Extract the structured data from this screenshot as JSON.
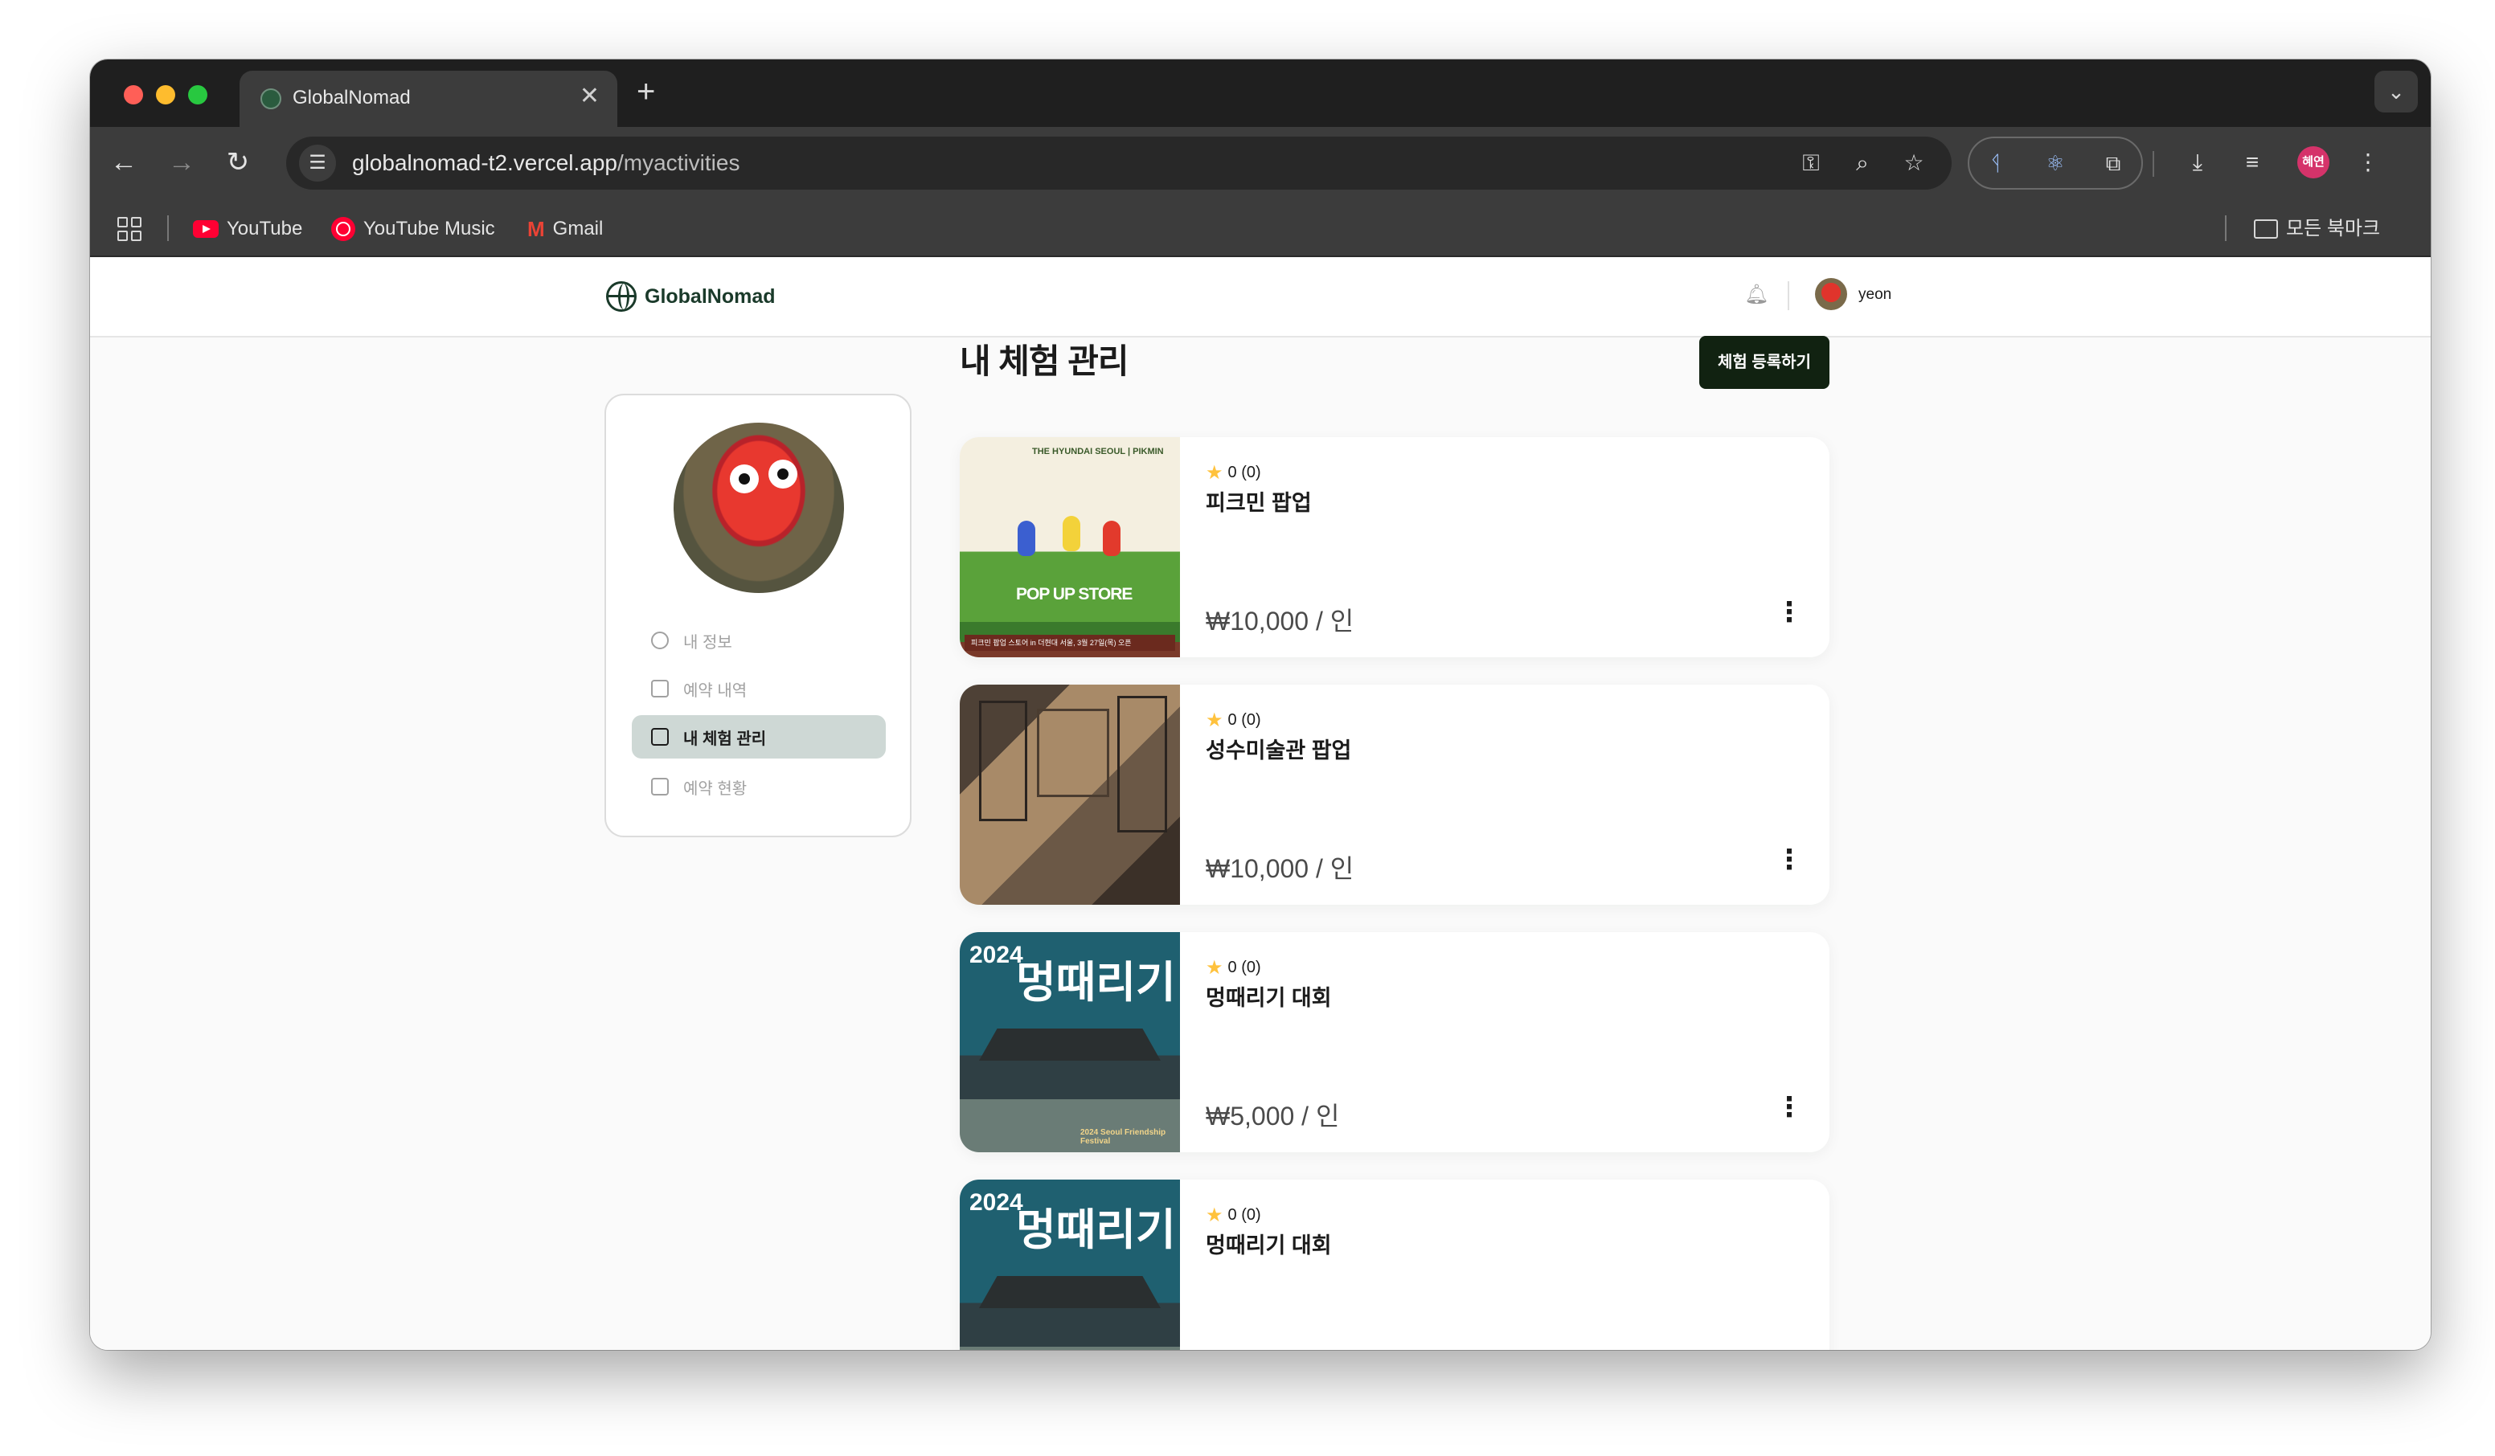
{
  "browser": {
    "tab_title": "GlobalNomad",
    "url_host": "globalnomad-t2.vercel.app",
    "url_path": "/myactivities",
    "profile_chip": "혜연",
    "bookmarks": [
      {
        "label": "YouTube",
        "icon": "youtube-icon"
      },
      {
        "label": "YouTube Music",
        "icon": "youtube-music-icon"
      },
      {
        "label": "Gmail",
        "icon": "gmail-icon"
      }
    ],
    "all_bookmarks": "모든 북마크"
  },
  "site": {
    "logo_text": "GlobalNomad",
    "username": "yeon"
  },
  "sidebar": {
    "items": [
      {
        "label": "내 정보",
        "icon": "user-icon",
        "active": false
      },
      {
        "label": "예약 내역",
        "icon": "list-icon",
        "active": false
      },
      {
        "label": "내 체험 관리",
        "icon": "calendar-check-icon",
        "active": true
      },
      {
        "label": "예약 현황",
        "icon": "calendar-icon",
        "active": false
      }
    ]
  },
  "main": {
    "title": "내 체험 관리",
    "register_button": "체험 등록하기",
    "activities": [
      {
        "rating": "0 (0)",
        "title": "피크민 팝업",
        "price": "₩10,000 / 인"
      },
      {
        "rating": "0 (0)",
        "title": "성수미술관 팝업",
        "price": "₩10,000 / 인"
      },
      {
        "rating": "0 (0)",
        "title": "멍때리기 대회",
        "price": "₩5,000 / 인"
      },
      {
        "rating": "0 (0)",
        "title": "멍때리기 대회",
        "price": ""
      }
    ],
    "thumbnails": {
      "pikmin_header": "THE HYUNDAI SEOUL | PIKMIN",
      "pikmin_popup": "POP UP STORE",
      "pikmin_banner": "피크민 팝업 스토어 in 더현대 서울, 3월 27일(목) 오픈",
      "palace_year": "2024",
      "palace_big": "멍때리기",
      "palace_bottom": "2024 Seoul Friendship Festival"
    }
  },
  "colors": {
    "brand_dark": "#112211",
    "active_nav": "#CED8D5",
    "star": "#FFC23D"
  }
}
